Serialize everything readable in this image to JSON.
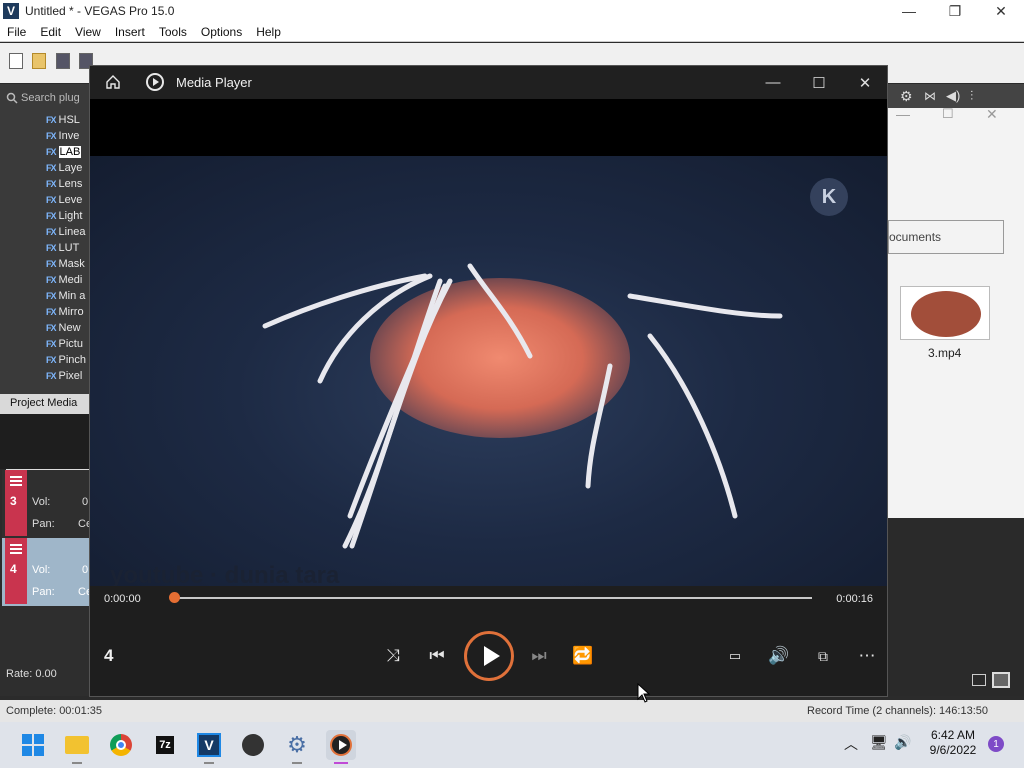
{
  "vegas": {
    "title": "Untitled * - VEGAS Pro 15.0",
    "logo_letter": "V",
    "window_buttons": [
      "—",
      "❐",
      "✕"
    ],
    "menu": [
      "File",
      "Edit",
      "View",
      "Insert",
      "Tools",
      "Options",
      "Help"
    ],
    "search_placeholder": "Search plug",
    "fx_badge": "FX",
    "fx_items": [
      "HSL",
      "Inve",
      "LAB",
      "Laye",
      "Lens",
      "Leve",
      "Light",
      "Linea",
      "LUT",
      "Mask",
      "Medi",
      "Min a",
      "Mirro",
      "New",
      "Pictu",
      "Pinch",
      "Pixel"
    ],
    "project_media_tab": "Project Media",
    "tracks": [
      {
        "num": "3",
        "vol_label": "Vol:",
        "vol_value": "0",
        "pan_label": "Pan:",
        "pan_value": "Ce"
      },
      {
        "num": "4",
        "vol_label": "Vol:",
        "vol_value": "0",
        "pan_label": "Pan:",
        "pan_value": "Ce"
      }
    ],
    "rate": "Rate: 0.00",
    "status_left": "Complete: 00:01:35",
    "status_right": "Record Time (2 channels): 146:13:50",
    "explorer": {
      "documents_label": "ocuments",
      "file_name": "3.mp4"
    }
  },
  "media_player": {
    "title": "Media Player",
    "window_buttons": [
      "—",
      "☐",
      "✕"
    ],
    "video": {
      "logo_letter": "K",
      "watermark": "youtube · dunia tara"
    },
    "time_current": "0:00:00",
    "time_total": "0:00:16",
    "progress_fraction": 0.0,
    "track_number": "4",
    "accent_color": "#e0713a"
  },
  "taskbar": {
    "time": "6:42 AM",
    "date": "9/6/2022",
    "notification_count": "1",
    "apps": [
      "start-icon",
      "file-explorer-icon",
      "chrome-icon",
      "7zip-icon",
      "vegas-icon",
      "wordpress-icon",
      "settings-icon",
      "media-player-icon"
    ],
    "app_labels": {
      "seven_zip": "7z",
      "vegas": "V"
    }
  }
}
